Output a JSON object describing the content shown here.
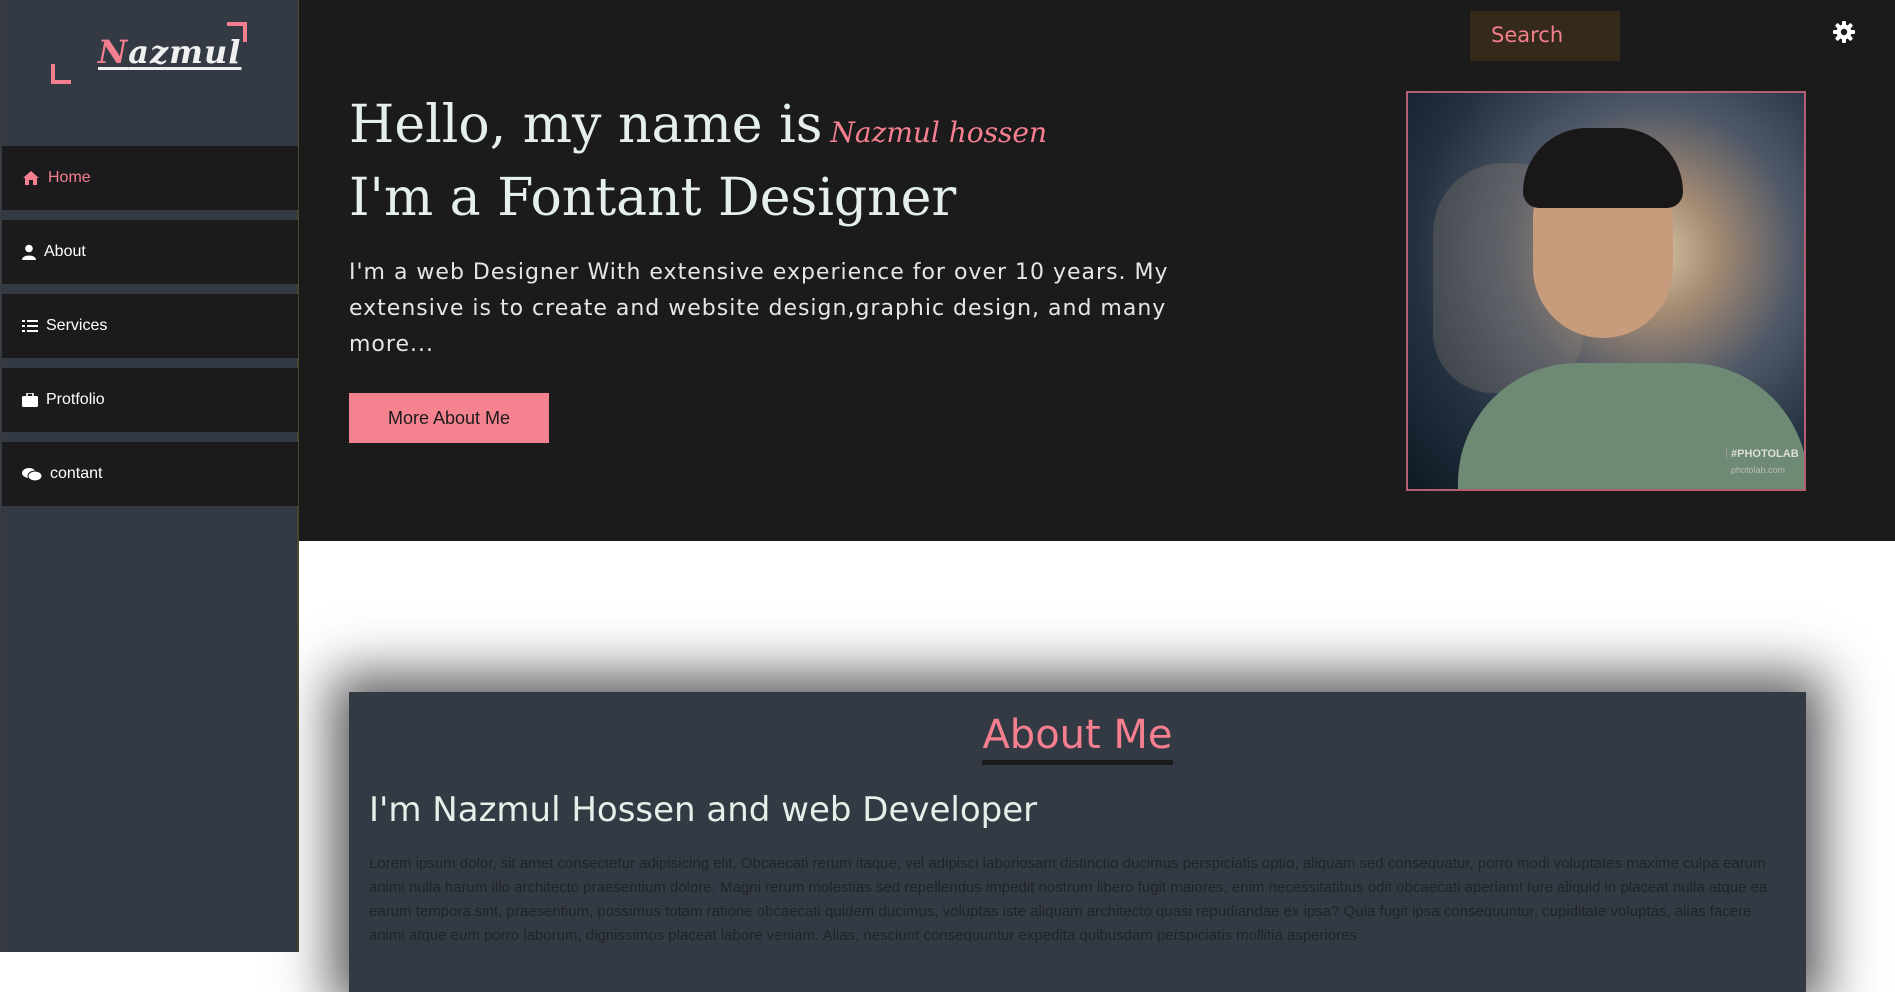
{
  "logo": {
    "first_letter": "N",
    "rest": "azmul"
  },
  "sidebar": {
    "items": [
      {
        "label": "Home",
        "icon": "home-icon",
        "active": true
      },
      {
        "label": "About",
        "icon": "user-icon",
        "active": false
      },
      {
        "label": "Services",
        "icon": "list-icon",
        "active": false
      },
      {
        "label": "Protfolio",
        "icon": "briefcase-icon",
        "active": false
      },
      {
        "label": "contant",
        "icon": "comments-icon",
        "active": false
      }
    ]
  },
  "header": {
    "search_label": "Search",
    "settings_icon": "gear-icon"
  },
  "hero": {
    "greeting": "Hello, my name is",
    "name": "Nazmul hossen",
    "role": "I'm a Fontant Designer",
    "intro": "I'm a web Designer With extensive experience for over 10 years. My extensive is to create and website design,graphic design, and many more...",
    "button_label": "More About Me",
    "watermark_title": "#PHOTOLAB",
    "watermark_sub": "photolab.com"
  },
  "about": {
    "title": "About Me",
    "subtitle": "I'm Nazmul Hossen and web Developer",
    "body": "Lorem ipsum dolor, sit amet consectetur adipisicing elit. Obcaecati rerum itaque, vel adipisci laboriosam distinctio ducimus perspiciatis optio, aliquam sed consequatur, porro modi voluptates maxime culpa earum animi nulla harum illo architecto praesentium dolore. Magni rerum molestias sed repellendus impedit nostrum libero fugit maiores, enim necessitatibus odit obcaecati aperiam! Iure aliquid in placeat nulla atque ea earum tempora sint, praesentium, possimus totam ratione obcaecati quidem ducimus, voluptas iste aliquam architecto quasi repudiandae ex ipsa? Quia fugit ipsa consequuntur, cupiditate voluptas, alias facere animi atque eum porro laborum, dignissimos placeat labore veniam. Alias, nesciunt consequuntur expedita quibusdam perspiciatis mollitia asperiores"
  },
  "colors": {
    "accent": "#f57f8f",
    "sidebar_bg": "#343a44",
    "hero_bg": "#1b1b1b",
    "nav_bg": "#1b1b1d"
  }
}
